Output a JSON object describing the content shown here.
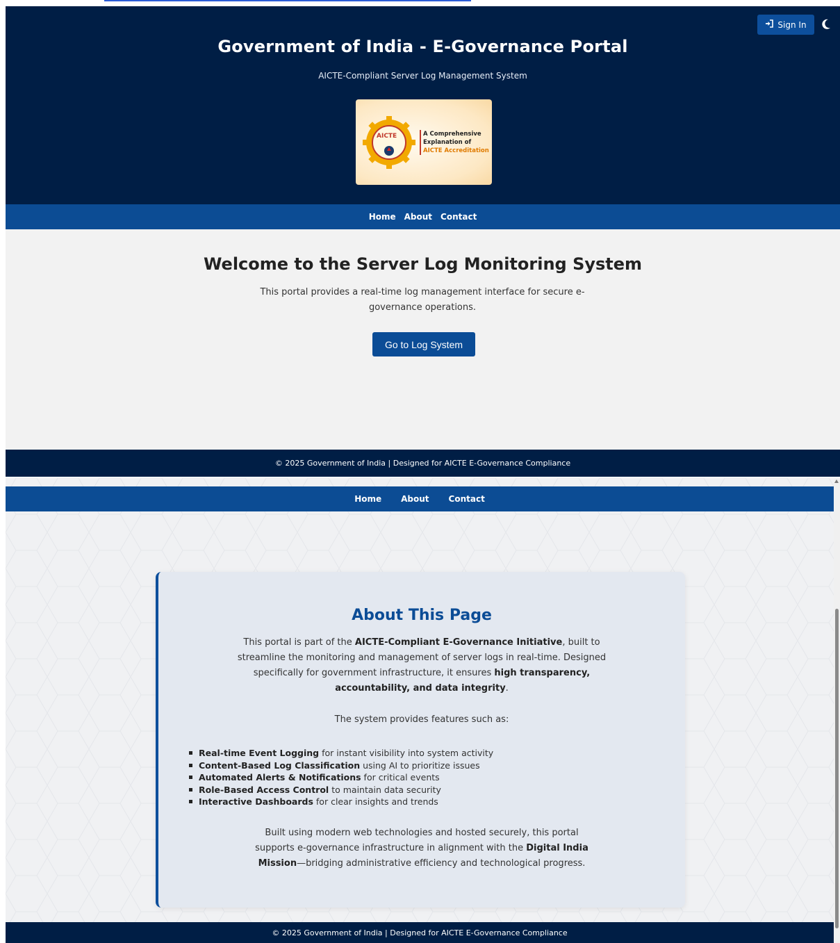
{
  "header": {
    "title": "Government of India - E-Governance Portal",
    "subtitle": "AICTE-Compliant Server Log Management System",
    "signin_label": "Sign In",
    "logo": {
      "badge": "AICTE",
      "line1": "A Comprehensive",
      "line2": "Explanation of",
      "line3": "AICTE Accreditation"
    }
  },
  "nav": {
    "home": "Home",
    "about": "About",
    "contact": "Contact"
  },
  "welcome": {
    "title": "Welcome to the Server Log Monitoring System",
    "text": "This portal provides a real-time log management interface for secure e-governance operations.",
    "button": "Go to Log System"
  },
  "footer": {
    "text": "© 2025 Government of India | Designed for AICTE E-Governance Compliance"
  },
  "about": {
    "title": "About This Page",
    "p1_a": "This portal is part of the ",
    "p1_b": "AICTE-Compliant E-Governance Initiative",
    "p1_c": ", built to streamline the monitoring and management of server logs in real-time. Designed specifically for government infrastructure, it ensures ",
    "p1_d": "high transparency, accountability, and data integrity",
    "p1_e": ".",
    "p2": "The system provides features such as:",
    "features": [
      {
        "bold": "Real-time Event Logging",
        "rest": " for instant visibility into system activity"
      },
      {
        "bold": "Content-Based Log Classification",
        "rest": " using AI to prioritize issues"
      },
      {
        "bold": "Automated Alerts & Notifications",
        "rest": " for critical events"
      },
      {
        "bold": "Role-Based Access Control",
        "rest": " to maintain data security"
      },
      {
        "bold": "Interactive Dashboards",
        "rest": " for clear insights and trends"
      }
    ],
    "p3_a": "Built using modern web technologies and hosted securely, this portal supports e-governance infrastructure in alignment with the ",
    "p3_b": "Digital India Mission",
    "p3_c": "—bridging administrative efficiency and technological progress."
  },
  "colors": {
    "header_bg": "#001e45",
    "nav_bg": "#0c4c94",
    "accent": "#0b4c96"
  },
  "icons": {
    "signin": "sign-in-icon",
    "theme": "moon-icon"
  }
}
